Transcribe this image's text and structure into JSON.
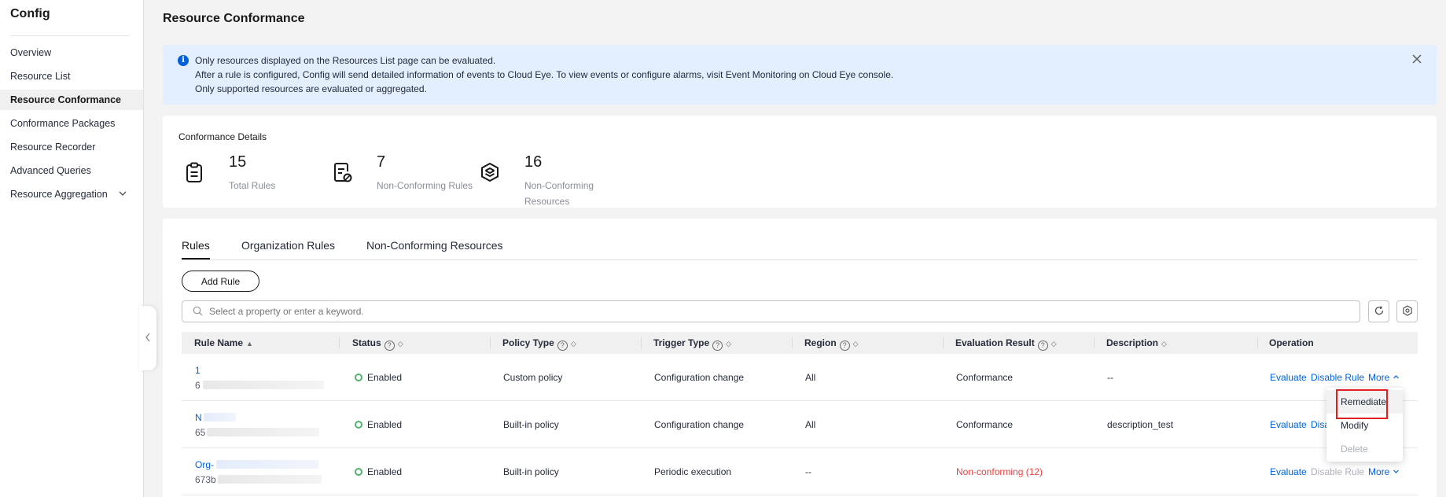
{
  "sidebar": {
    "title": "Config",
    "items": [
      {
        "label": "Overview"
      },
      {
        "label": "Resource List"
      },
      {
        "label": "Resource Conformance"
      },
      {
        "label": "Conformance Packages"
      },
      {
        "label": "Resource Recorder"
      },
      {
        "label": "Advanced Queries"
      },
      {
        "label": "Resource Aggregation"
      }
    ]
  },
  "page": {
    "title": "Resource Conformance"
  },
  "alert": {
    "lines": [
      "Only resources displayed on the Resources List page can be evaluated.",
      "After a rule is configured, Config will send detailed information of events to Cloud Eye. To view events or configure alarms, visit Event Monitoring on Cloud Eye console.",
      "Only supported resources are evaluated or aggregated."
    ]
  },
  "details": {
    "title": "Conformance Details",
    "stats": [
      {
        "value": "15",
        "label": "Total Rules"
      },
      {
        "value": "7",
        "label": "Non-Conforming Rules"
      },
      {
        "value": "16",
        "label_line1": "Non-Conforming",
        "label_line2": "Resources"
      }
    ]
  },
  "tabs": [
    "Rules",
    "Organization Rules",
    "Non-Conforming Resources"
  ],
  "toolbar": {
    "add_label": "Add Rule",
    "search_placeholder": "Select a property or enter a keyword."
  },
  "table": {
    "headers": [
      "Rule Name",
      "Status",
      "Policy Type",
      "Trigger Type",
      "Region",
      "Evaluation Result",
      "Description",
      "Operation"
    ],
    "rows": [
      {
        "name": "1",
        "id": "6",
        "status": "Enabled",
        "policy": "Custom policy",
        "trigger": "Configuration change",
        "region": "All",
        "result": "Conformance",
        "description": "--",
        "op1": "Evaluate",
        "op2": "Disable Rule",
        "op3": "More"
      },
      {
        "name": "N",
        "id": "65",
        "status": "Enabled",
        "policy": "Built-in policy",
        "trigger": "Configuration change",
        "region": "All",
        "result": "Conformance",
        "description": "description_test",
        "op1": "Evaluate",
        "op2": "Disal"
      },
      {
        "name": "Org-",
        "id": "673b",
        "status": "Enabled",
        "policy": "Built-in policy",
        "trigger": "Periodic execution",
        "region": "--",
        "result": "Non-conforming (12)",
        "description": "",
        "op1": "Evaluate",
        "op2": "Disable Rule",
        "op3": "More"
      }
    ]
  },
  "dropdown": {
    "items": [
      "Remediate",
      "Modify",
      "Delete"
    ]
  },
  "colors": {
    "accent": "#0062db",
    "danger": "#e54545",
    "success": "#50b370",
    "highlight": "#e02020"
  },
  "icons": [
    "info-icon",
    "close-icon",
    "clipboard-icon",
    "file-check-icon",
    "layers-icon",
    "search-icon",
    "refresh-icon",
    "settings-icon",
    "chevron-down-icon",
    "chevron-up-icon",
    "chevron-left-icon"
  ]
}
